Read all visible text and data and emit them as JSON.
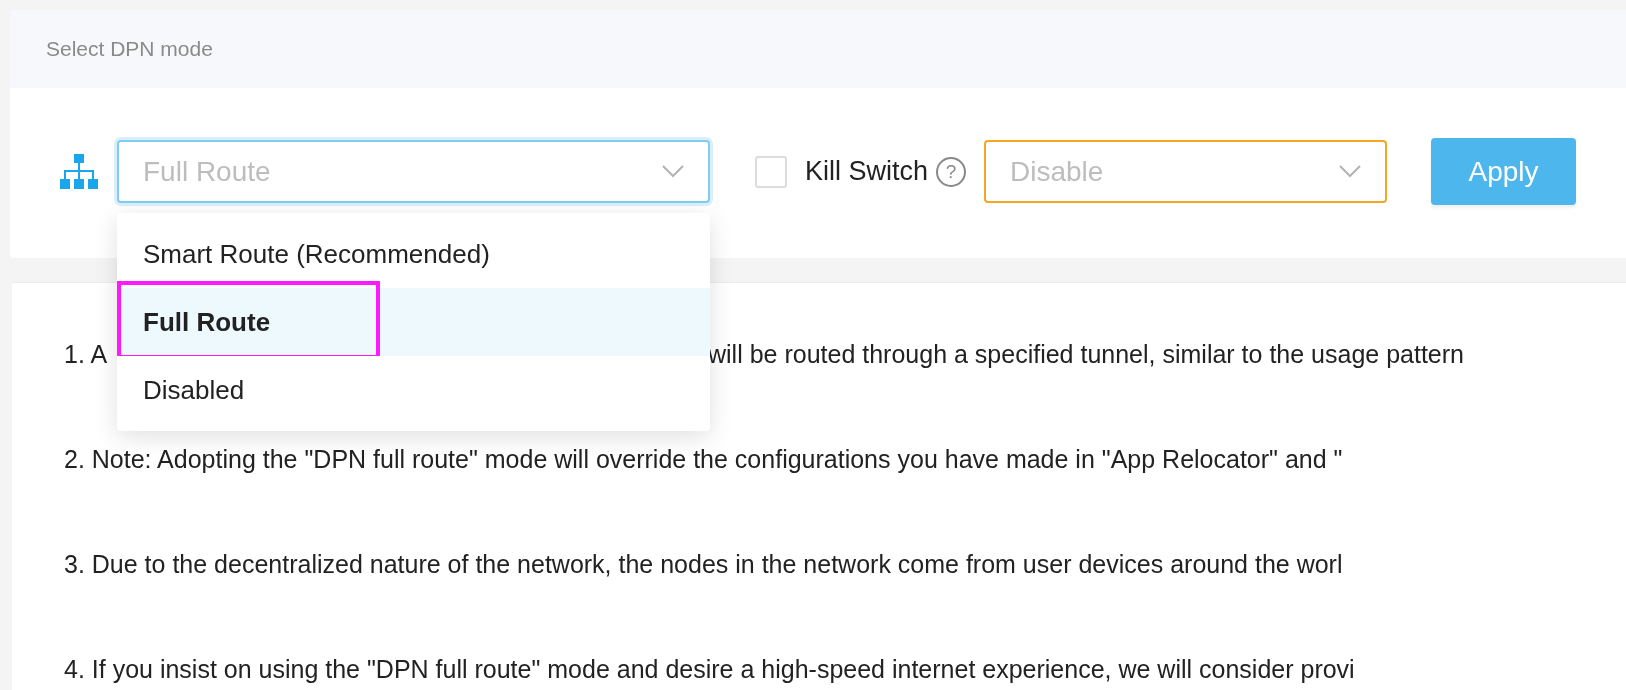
{
  "header": {
    "title": "Select DPN mode"
  },
  "mode_select": {
    "placeholder": "Full Route",
    "expanded": true,
    "options": [
      {
        "label": "Smart Route (Recommended)",
        "selected": false,
        "annotated": false
      },
      {
        "label": "Full Route",
        "selected": true,
        "annotated": true
      },
      {
        "label": "Disabled",
        "selected": false,
        "annotated": false
      }
    ]
  },
  "kill_switch": {
    "label": "Kill Switch",
    "checked": false,
    "help": "?",
    "select": {
      "placeholder": "Disable"
    }
  },
  "apply_button": {
    "label": "Apply"
  },
  "notes": [
    {
      "parts": [
        "1. A",
        "will be routed through a specified tunnel, similar to the usage pattern"
      ]
    },
    {
      "parts": [
        "2. Note: Adopting the \"DPN full route\" mode will override the configurations you have made in \"App Relocator\" and \""
      ]
    },
    {
      "parts": [
        "3. Due to the decentralized nature of the network, the nodes in the network come from user devices around the worl"
      ]
    },
    {
      "parts": [
        "4. If you insist on using the \"DPN full route\" mode and desire a high-speed internet experience, we will consider provi"
      ]
    }
  ]
}
